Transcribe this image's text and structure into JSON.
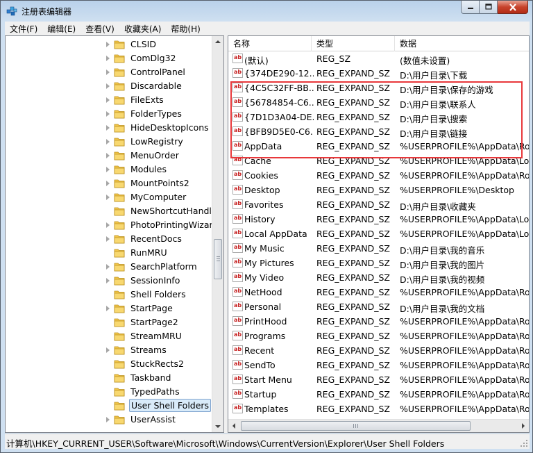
{
  "window": {
    "title": "注册表编辑器",
    "title_icon": "registry-editor-icon",
    "controls": [
      "minimize",
      "maximize",
      "close"
    ]
  },
  "menubar": [
    {
      "label": "文件(F)"
    },
    {
      "label": "编辑(E)"
    },
    {
      "label": "查看(V)"
    },
    {
      "label": "收藏夹(A)"
    },
    {
      "label": "帮助(H)"
    }
  ],
  "tree": {
    "items": [
      {
        "label": "CLSID",
        "expandable": true
      },
      {
        "label": "ComDlg32",
        "expandable": true
      },
      {
        "label": "ControlPanel",
        "expandable": true
      },
      {
        "label": "Discardable",
        "expandable": true
      },
      {
        "label": "FileExts",
        "expandable": true
      },
      {
        "label": "FolderTypes",
        "expandable": true
      },
      {
        "label": "HideDesktopIcons",
        "expandable": true
      },
      {
        "label": "LowRegistry",
        "expandable": true
      },
      {
        "label": "MenuOrder",
        "expandable": true
      },
      {
        "label": "Modules",
        "expandable": true
      },
      {
        "label": "MountPoints2",
        "expandable": true
      },
      {
        "label": "MyComputer",
        "expandable": true
      },
      {
        "label": "NewShortcutHandlers",
        "expandable": false
      },
      {
        "label": "PhotoPrintingWizard",
        "expandable": true
      },
      {
        "label": "RecentDocs",
        "expandable": true
      },
      {
        "label": "RunMRU",
        "expandable": false
      },
      {
        "label": "SearchPlatform",
        "expandable": true
      },
      {
        "label": "SessionInfo",
        "expandable": true
      },
      {
        "label": "Shell Folders",
        "expandable": false
      },
      {
        "label": "StartPage",
        "expandable": true
      },
      {
        "label": "StartPage2",
        "expandable": false
      },
      {
        "label": "StreamMRU",
        "expandable": false
      },
      {
        "label": "Streams",
        "expandable": true
      },
      {
        "label": "StuckRects2",
        "expandable": false
      },
      {
        "label": "Taskband",
        "expandable": false
      },
      {
        "label": "TypedPaths",
        "expandable": false
      },
      {
        "label": "User Shell Folders",
        "expandable": false,
        "selected": true
      },
      {
        "label": "UserAssist",
        "expandable": true
      }
    ]
  },
  "list": {
    "columns": {
      "name": "名称",
      "type": "类型",
      "data": "数据"
    },
    "rows": [
      {
        "name": "(默认)",
        "type": "REG_SZ",
        "data": "(数值未设置)"
      },
      {
        "name": "{374DE290-12...",
        "type": "REG_EXPAND_SZ",
        "data": "D:\\用户目录\\下载"
      },
      {
        "name": "{4C5C32FF-BB...",
        "type": "REG_EXPAND_SZ",
        "data": "D:\\用户目录\\保存的游戏"
      },
      {
        "name": "{56784854-C6...",
        "type": "REG_EXPAND_SZ",
        "data": "D:\\用户目录\\联系人"
      },
      {
        "name": "{7D1D3A04-DE...",
        "type": "REG_EXPAND_SZ",
        "data": "D:\\用户目录\\搜索"
      },
      {
        "name": "{BFB9D5E0-C6...",
        "type": "REG_EXPAND_SZ",
        "data": "D:\\用户目录\\链接"
      },
      {
        "name": "AppData",
        "type": "REG_EXPAND_SZ",
        "data": "%USERPROFILE%\\AppData\\Roa"
      },
      {
        "name": "Cache",
        "type": "REG_EXPAND_SZ",
        "data": "%USERPROFILE%\\AppData\\Loc"
      },
      {
        "name": "Cookies",
        "type": "REG_EXPAND_SZ",
        "data": "%USERPROFILE%\\AppData\\Roa"
      },
      {
        "name": "Desktop",
        "type": "REG_EXPAND_SZ",
        "data": "%USERPROFILE%\\Desktop"
      },
      {
        "name": "Favorites",
        "type": "REG_EXPAND_SZ",
        "data": "D:\\用户目录\\收藏夹"
      },
      {
        "name": "History",
        "type": "REG_EXPAND_SZ",
        "data": "%USERPROFILE%\\AppData\\Loc"
      },
      {
        "name": "Local AppData",
        "type": "REG_EXPAND_SZ",
        "data": "%USERPROFILE%\\AppData\\Loc"
      },
      {
        "name": "My Music",
        "type": "REG_EXPAND_SZ",
        "data": "D:\\用户目录\\我的音乐"
      },
      {
        "name": "My Pictures",
        "type": "REG_EXPAND_SZ",
        "data": "D:\\用户目录\\我的图片"
      },
      {
        "name": "My Video",
        "type": "REG_EXPAND_SZ",
        "data": "D:\\用户目录\\我的视频"
      },
      {
        "name": "NetHood",
        "type": "REG_EXPAND_SZ",
        "data": "%USERPROFILE%\\AppData\\Roa"
      },
      {
        "name": "Personal",
        "type": "REG_EXPAND_SZ",
        "data": "D:\\用户目录\\我的文档"
      },
      {
        "name": "PrintHood",
        "type": "REG_EXPAND_SZ",
        "data": "%USERPROFILE%\\AppData\\Roa"
      },
      {
        "name": "Programs",
        "type": "REG_EXPAND_SZ",
        "data": "%USERPROFILE%\\AppData\\Roa"
      },
      {
        "name": "Recent",
        "type": "REG_EXPAND_SZ",
        "data": "%USERPROFILE%\\AppData\\Roa"
      },
      {
        "name": "SendTo",
        "type": "REG_EXPAND_SZ",
        "data": "%USERPROFILE%\\AppData\\Roa"
      },
      {
        "name": "Start Menu",
        "type": "REG_EXPAND_SZ",
        "data": "%USERPROFILE%\\AppData\\Roa"
      },
      {
        "name": "Startup",
        "type": "REG_EXPAND_SZ",
        "data": "%USERPROFILE%\\AppData\\Roa"
      },
      {
        "name": "Templates",
        "type": "REG_EXPAND_SZ",
        "data": "%USERPROFILE%\\AppData\\Roa"
      }
    ],
    "value_icon": "string-value-icon"
  },
  "statusbar": {
    "path": "计算机\\HKEY_CURRENT_USER\\Software\\Microsoft\\Windows\\CurrentVersion\\Explorer\\User Shell Folders"
  },
  "colors": {
    "selection_highlight": "#d9ebf9",
    "annotation_box": "#e8383b",
    "folder": "#f3c649"
  }
}
